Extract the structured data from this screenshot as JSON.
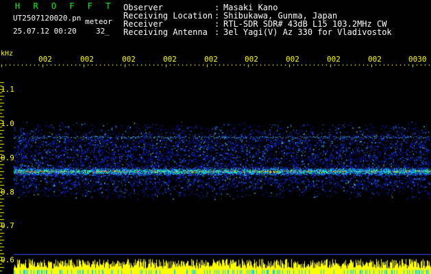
{
  "header": {
    "brand": "H R O F F T",
    "filename": "UT2507120020.pn",
    "tag": "meteor",
    "datetime": "25.07.12 00:20",
    "count": "32_",
    "info": [
      {
        "label": "Observer",
        "sep": ":",
        "value": "Masaki Kano"
      },
      {
        "label": "Receiving Location",
        "sep": ":",
        "value": "Shibukawa, Gunma, Japan"
      },
      {
        "label": "Receiver",
        "sep": ":",
        "value": "RTL-SDR SDR# 43dB L15 103.2MHz CW"
      },
      {
        "label": "Receiving Antenna",
        "sep": ":",
        "value": "3el Yagi(V) Az 330 for Vladivostok"
      }
    ]
  },
  "axes": {
    "unit": "kHz",
    "time_ticks": [
      "002",
      "002",
      "002",
      "002",
      "002",
      "002",
      "002",
      "002",
      "002",
      "0030"
    ],
    "freq_ticks": [
      "1.1",
      "1.0",
      "0.9",
      "0.8",
      "0.7",
      "0.6"
    ]
  },
  "colors": {
    "background": "#000000",
    "text": "#ffffff",
    "brand": "#00ff00",
    "axis": "#ffff00",
    "signal_low": "#0000ff",
    "signal_mid": "#00ffff",
    "signal_high": "#ff0000"
  },
  "spectrum": {
    "main_band_khz": 0.86,
    "secondary_band_khz": 0.96,
    "noise_range_khz": [
      0.8,
      0.98
    ]
  }
}
